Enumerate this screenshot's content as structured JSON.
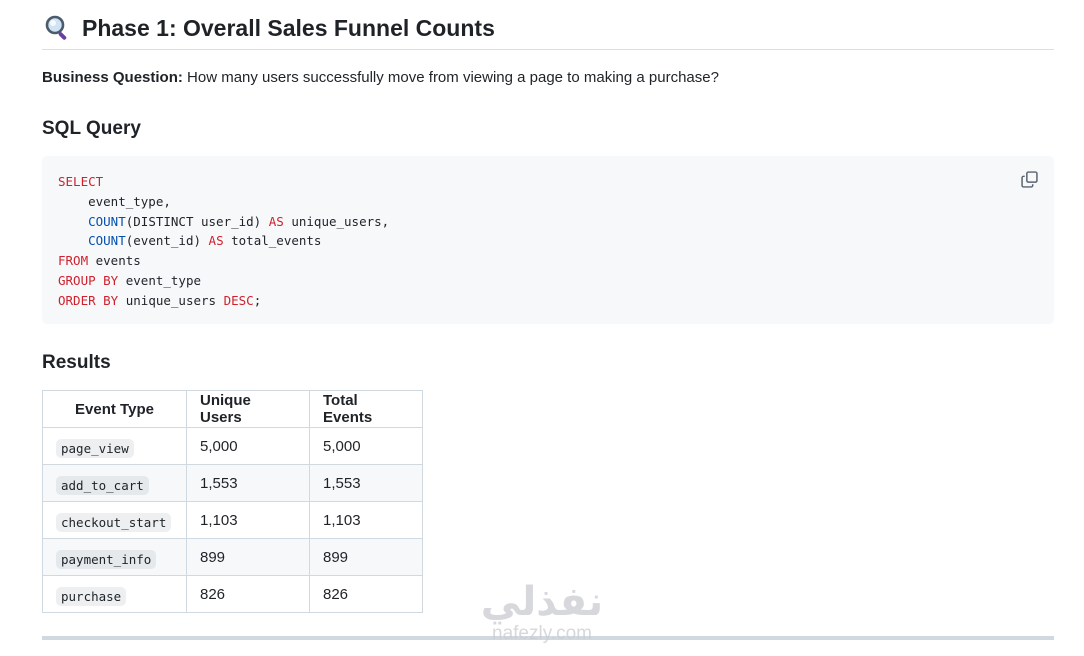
{
  "heading": {
    "icon": "magnifying-glass-icon",
    "title": "Phase 1: Overall Sales Funnel Counts"
  },
  "question": {
    "label": "Business Question:",
    "text": " How many users successfully move from viewing a page to making a purchase?"
  },
  "sql_section": {
    "title": "SQL Query",
    "copy_icon": "copy-icon",
    "code_lines": [
      [
        {
          "t": "SELECT",
          "k": "kw"
        }
      ],
      [
        {
          "t": "    event_type,",
          "k": ""
        }
      ],
      [
        {
          "t": "    ",
          "k": ""
        },
        {
          "t": "COUNT",
          "k": "fn"
        },
        {
          "t": "(DISTINCT user_id) ",
          "k": ""
        },
        {
          "t": "AS",
          "k": "kw"
        },
        {
          "t": " unique_users,",
          "k": ""
        }
      ],
      [
        {
          "t": "    ",
          "k": ""
        },
        {
          "t": "COUNT",
          "k": "fn"
        },
        {
          "t": "(event_id) ",
          "k": ""
        },
        {
          "t": "AS",
          "k": "kw"
        },
        {
          "t": " total_events",
          "k": ""
        }
      ],
      [
        {
          "t": "FROM",
          "k": "kw"
        },
        {
          "t": " events",
          "k": ""
        }
      ],
      [
        {
          "t": "GROUP BY",
          "k": "kw"
        },
        {
          "t": " event_type",
          "k": ""
        }
      ],
      [
        {
          "t": "ORDER BY",
          "k": "kw"
        },
        {
          "t": " unique_users ",
          "k": ""
        },
        {
          "t": "DESC",
          "k": "kw"
        },
        {
          "t": ";",
          "k": ""
        }
      ]
    ],
    "colors": {
      "keyword": "#cf222e",
      "function": "#0550ae"
    }
  },
  "results": {
    "title": "Results",
    "columns": [
      "Event Type",
      "Unique Users",
      "Total Events"
    ],
    "rows": [
      [
        "page_view",
        "5,000",
        "5,000"
      ],
      [
        "add_to_cart",
        "1,553",
        "1,553"
      ],
      [
        "checkout_start",
        "1,103",
        "1,103"
      ],
      [
        "payment_info",
        "899",
        "899"
      ],
      [
        "purchase",
        "826",
        "826"
      ]
    ]
  },
  "watermark": {
    "arabic": "نفذلي",
    "latin": "nafezly.com"
  }
}
